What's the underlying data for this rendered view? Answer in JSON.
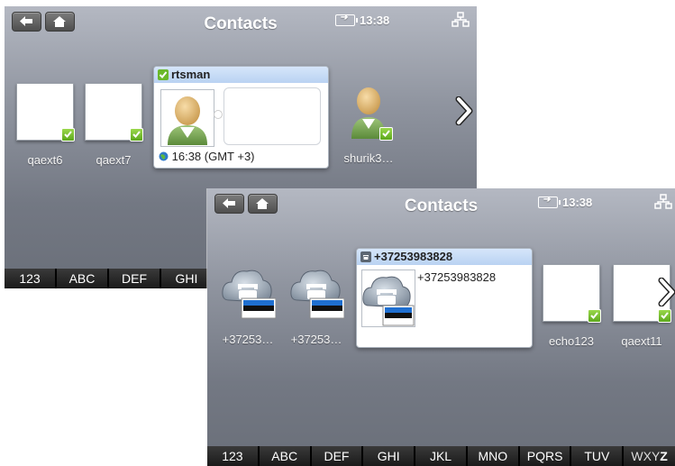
{
  "back_window": {
    "title": "Contacts",
    "clock": "13:38",
    "contacts": [
      {
        "name": "qaext6",
        "online": true
      },
      {
        "name": "qaext7",
        "online": true
      }
    ],
    "selected": {
      "name": "rtsman",
      "online": true,
      "local_time": "16:38 (GMT +3)"
    },
    "right_contact": {
      "name": "shurik3…",
      "online": true
    },
    "abc_keys": [
      "123",
      "ABC",
      "DEF",
      "GHI"
    ]
  },
  "front_window": {
    "title": "Contacts",
    "clock": "13:38",
    "contacts": [
      {
        "name": "+37253…",
        "icon": "phone-contact-icon"
      },
      {
        "name": "+37253…",
        "icon": "phone-contact-icon"
      }
    ],
    "selected": {
      "header": "+37253983828",
      "number": "+37253983828"
    },
    "right_contacts": [
      {
        "name": "echo123",
        "online": true
      },
      {
        "name": "qaext11",
        "online": true
      }
    ],
    "abc_keys": [
      "123",
      "ABC",
      "DEF",
      "GHI",
      "JKL",
      "MNO",
      "PQRS",
      "TUV"
    ],
    "abc_last_prefix": "WXY",
    "abc_last_suffix": "Z"
  },
  "colors": {
    "online_badge": "#6ab82a",
    "header_blue": "#c5dbf6",
    "screen_bg": "#8f949f"
  }
}
